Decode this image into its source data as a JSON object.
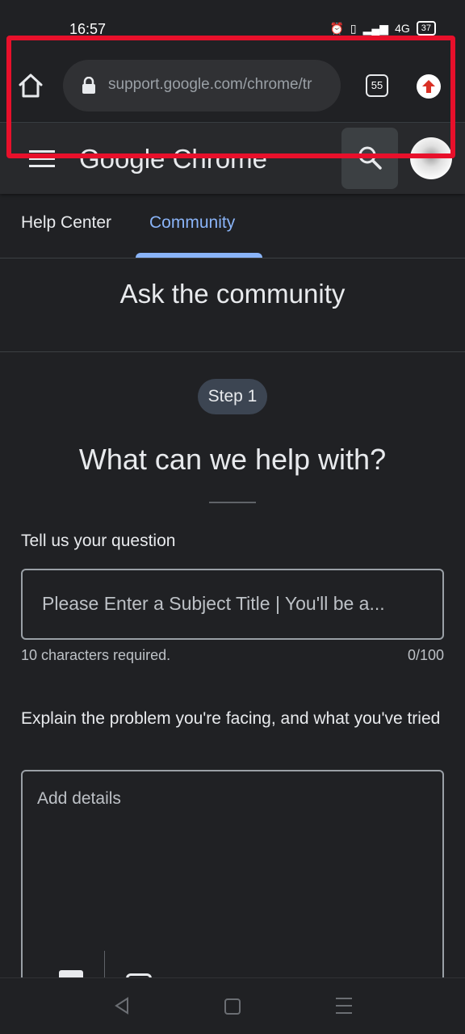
{
  "status_bar": {
    "time": "16:57",
    "network": "4G",
    "battery": "37"
  },
  "browser": {
    "url": "support.google.com/chrome/tr",
    "tab_count": "55",
    "icons": [
      "home-icon",
      "lock-icon",
      "tab-switcher-icon",
      "update-icon"
    ]
  },
  "site": {
    "title": "Google Chrome",
    "icons": [
      "menu-icon",
      "search-icon",
      "avatar"
    ]
  },
  "tabs": [
    {
      "label": "Help Center",
      "active": false
    },
    {
      "label": "Community",
      "active": true
    }
  ],
  "page": {
    "heading": "Ask the community",
    "step": "Step 1",
    "subheading": "What can we help with?"
  },
  "question": {
    "label": "Tell us your question",
    "placeholder": "Please Enter a Subject Title | You'll be a...",
    "hint": "10 characters required.",
    "count": "0/100"
  },
  "details": {
    "label": "Explain the problem you're facing, and what you've tried",
    "placeholder": "Add details"
  },
  "colors": {
    "background": "#202124",
    "accent": "#8ab4f8",
    "highlight": "#e8102b"
  }
}
